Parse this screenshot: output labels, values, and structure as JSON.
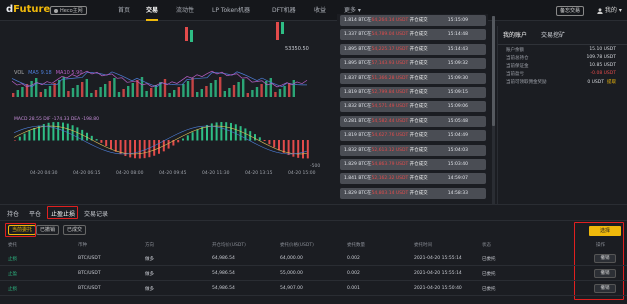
{
  "header": {
    "logo_a": "d",
    "logo_b": "Future",
    "badge": "Heco主网",
    "nav": [
      "首页",
      "交易",
      "流动性",
      "LP Token机器",
      "DFT机器",
      "收益",
      "更多"
    ],
    "nav_active_index": 1,
    "switch_btn": "备忘交易",
    "user": "我的"
  },
  "chart": {
    "price_label": "53350.50",
    "ma_labels": [
      "VOL",
      "MA5 9.18",
      "MA10 5.90"
    ],
    "macd_label": "MACD 28.55  DIF -174.33  DEA -198.80",
    "macd_axis": "-500",
    "x_ticks": [
      "04-20 04:30",
      "04-20 06:15",
      "04-20 08:00",
      "04-20 09:45",
      "04-20 11:30",
      "04-20 13:15",
      "04-20 15:00"
    ],
    "colors": {
      "up": "#2ebd85",
      "down": "#e34b4b",
      "ma5": "#4e7ed8",
      "ma10": "#b85fc7"
    }
  },
  "orders": [
    {
      "qty": "1.814 BTC在",
      "hash": "64,264.14 USDT",
      "st": "开仓成交",
      "time": "15:15:09"
    },
    {
      "qty": "1.337 BTC在",
      "hash": "54,789.04 USDT",
      "st": "开仓成交",
      "time": "15:14:48"
    },
    {
      "qty": "1.895 BTC在",
      "hash": "54,225.17 USDT",
      "st": "开仓成交",
      "time": "15:14:43"
    },
    {
      "qty": "1.895 BTC在",
      "hash": "57,143.93 USDT",
      "st": "开仓成交",
      "time": "15:09:32"
    },
    {
      "qty": "1.837 BTC在",
      "hash": "51,366.28 USDT",
      "st": "开仓成交",
      "time": "15:09:30"
    },
    {
      "qty": "1.819 BTC在",
      "hash": "52,799.84 USDT",
      "st": "开仓成交",
      "time": "15:09:15"
    },
    {
      "qty": "1.832 BTC在",
      "hash": "54,571.49 USDT",
      "st": "开仓成交",
      "time": "15:09:06"
    },
    {
      "qty": "0.281 BTC在",
      "hash": "54,582.44 USDT",
      "st": "开仓成交",
      "time": "15:05:48"
    },
    {
      "qty": "1.819 BTC在",
      "hash": "54,627.76 USDT",
      "st": "开仓成交",
      "time": "15:04:49"
    },
    {
      "qty": "1.832 BTC在",
      "hash": "52,613.12 USDT",
      "st": "开仓成交",
      "time": "15:04:03"
    },
    {
      "qty": "1.829 BTC在",
      "hash": "54,863.79 USDT",
      "st": "开仓成交",
      "time": "15:03:40"
    },
    {
      "qty": "1.841 BTC在",
      "hash": "52,162.32 USDT",
      "st": "开仓成交",
      "time": "14:59:07"
    },
    {
      "qty": "1.829 BTC在",
      "hash": "54,803.14 USDT",
      "st": "开仓成交",
      "time": "14:58:33"
    }
  ],
  "account": {
    "tabs": [
      "我的账户",
      "交易挖矿"
    ],
    "rows": [
      {
        "label": "账户余额",
        "value": "15.10 USDT"
      },
      {
        "label": "当前总持仓",
        "value": "109.78 USDT"
      },
      {
        "label": "当前保证金",
        "value": "10.85 USDT"
      },
      {
        "label": "当前盈亏",
        "value": "-0.08 USDT"
      },
      {
        "label": "当前可领取佣金奖励",
        "value": "0 USDT",
        "action": "提取"
      }
    ]
  },
  "bottom": {
    "tabs": [
      "持仓",
      "平仓",
      "止盈止损",
      "交易记录"
    ],
    "active_tab": 2,
    "filters": [
      "当前委托",
      "已撤销",
      "已成交"
    ],
    "select_btn": "选择",
    "headers": [
      "委托",
      "币种",
      "方向",
      "开仓均价(USDT)",
      "委托价格(USDT)",
      "委托数量",
      "委托时间",
      "状态",
      "操作"
    ],
    "rows": [
      {
        "side": "止损",
        "coin": "BTC/USDT",
        "dir": "做多",
        "open": "64,986.54",
        "price": "64,000.00",
        "qty": "0.002",
        "time": "2021-04-20 15:55:14",
        "status": "已委托",
        "op": "撤销"
      },
      {
        "side": "止盈",
        "coin": "BTC/USDT",
        "dir": "做多",
        "open": "54,986.54",
        "price": "55,000.00",
        "qty": "0.002",
        "time": "2021-04-20 15:55:14",
        "status": "已委托",
        "op": "撤销"
      },
      {
        "side": "止损",
        "coin": "BTC/USDT",
        "dir": "做多",
        "open": "54,986.54",
        "price": "54,907.00",
        "qty": "0.001",
        "time": "2021-04-20 15:50:40",
        "status": "已委托",
        "op": "撤销"
      }
    ]
  }
}
